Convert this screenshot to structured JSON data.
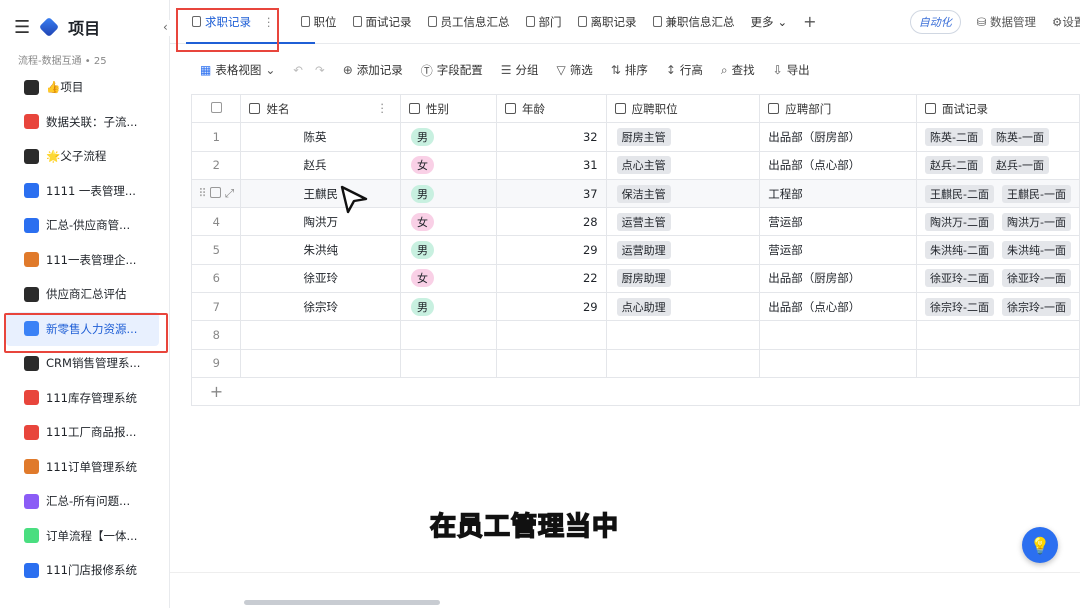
{
  "app": {
    "title": "项目",
    "subtitle": "流程-数据互通 • 25"
  },
  "sidebar": {
    "items": [
      {
        "label": "👍项目",
        "color": "#2b2b2b"
      },
      {
        "label": "数据关联：子流...",
        "color": "#e8453c"
      },
      {
        "label": "🌟父子流程",
        "color": "#2b2b2b"
      },
      {
        "label": "1111 一表管理...",
        "color": "#2b6ff0"
      },
      {
        "label": "汇总-供应商管...",
        "color": "#2b6ff0"
      },
      {
        "label": "111一表管理企...",
        "color": "#e07a2b"
      },
      {
        "label": "供应商汇总评估",
        "color": "#2b2b2b"
      },
      {
        "label": "新零售人力资源...",
        "color": "#3b82f6",
        "active": true
      },
      {
        "label": "CRM销售管理系...",
        "color": "#2b2b2b"
      },
      {
        "label": "111库存管理系统",
        "color": "#e8453c"
      },
      {
        "label": "111工厂商品报...",
        "color": "#e8453c"
      },
      {
        "label": "111订单管理系统",
        "color": "#e07a2b"
      },
      {
        "label": "汇总-所有问题...",
        "color": "#8b5cf6"
      },
      {
        "label": "订单流程【一体...",
        "color": "#4ade80"
      },
      {
        "label": "111门店报修系统",
        "color": "#2b6ff0"
      }
    ]
  },
  "tabs": [
    {
      "label": "求职记录",
      "active": true
    },
    {
      "label": "职位"
    },
    {
      "label": "面试记录"
    },
    {
      "label": "员工信息汇总"
    },
    {
      "label": "部门"
    },
    {
      "label": "离职记录"
    },
    {
      "label": "兼职信息汇总"
    },
    {
      "label": "更多"
    }
  ],
  "top_right": {
    "auto": "自动化",
    "data_manage": "数据管理",
    "settings": "设置"
  },
  "toolbar": {
    "view": "表格视图",
    "add": "添加记录",
    "fields": "字段配置",
    "group": "分组",
    "filter": "筛选",
    "sort": "排序",
    "row_height": "行高",
    "find": "查找",
    "export": "导出"
  },
  "table": {
    "headers": [
      "姓名",
      "性别",
      "年龄",
      "应聘职位",
      "应聘部门",
      "面试记录"
    ],
    "rows": [
      {
        "n": "1",
        "name": "陈英",
        "gender": "男",
        "age": "32",
        "pos": "厨房主管",
        "dept": "出品部（厨房部）",
        "rec": [
          "陈英-二面",
          "陈英-一面"
        ]
      },
      {
        "n": "2",
        "name": "赵兵",
        "gender": "女",
        "age": "31",
        "pos": "点心主管",
        "dept": "出品部（点心部）",
        "rec": [
          "赵兵-二面",
          "赵兵-一面"
        ]
      },
      {
        "n": "",
        "name": "王麒民",
        "gender": "男",
        "age": "37",
        "pos": "保洁主管",
        "dept": "工程部",
        "rec": [
          "王麒民-二面",
          "王麒民-一面"
        ]
      },
      {
        "n": "4",
        "name": "陶洪万",
        "gender": "女",
        "age": "28",
        "pos": "运营主管",
        "dept": "营运部",
        "rec": [
          "陶洪万-二面",
          "陶洪万-一面"
        ]
      },
      {
        "n": "5",
        "name": "朱洪纯",
        "gender": "男",
        "age": "29",
        "pos": "运营助理",
        "dept": "营运部",
        "rec": [
          "朱洪纯-二面",
          "朱洪纯-一面"
        ]
      },
      {
        "n": "6",
        "name": "徐亚玲",
        "gender": "女",
        "age": "22",
        "pos": "厨房助理",
        "dept": "出品部（厨房部）",
        "rec": [
          "徐亚玲-二面",
          "徐亚玲-一面"
        ]
      },
      {
        "n": "7",
        "name": "徐宗玲",
        "gender": "男",
        "age": "29",
        "pos": "点心助理",
        "dept": "出品部（点心部）",
        "rec": [
          "徐宗玲-二面",
          "徐宗玲-一面"
        ]
      }
    ],
    "empty_rows": [
      "8",
      "9"
    ],
    "add_row": "+"
  },
  "caption": "在员工管理当中"
}
